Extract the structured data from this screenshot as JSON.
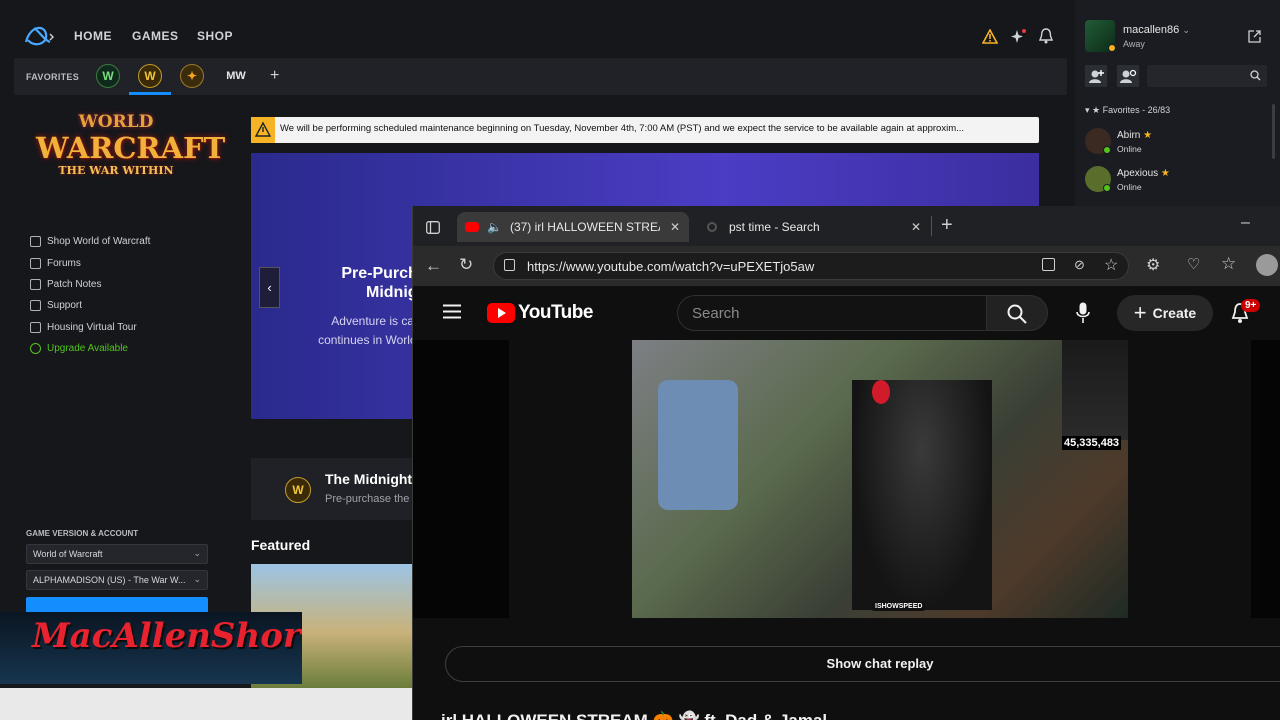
{
  "topnav": {
    "home": "HOME",
    "games": "GAMES",
    "shop": "SHOP"
  },
  "favorites": {
    "label": "FAVORITES",
    "add": "+",
    "games": [
      "WoW Classic",
      "World of Warcraft",
      "Hearthstone",
      "MW"
    ]
  },
  "user": {
    "name": "macallen86",
    "status": "Away"
  },
  "friends": {
    "header": "Favorites - 26/83",
    "list": [
      {
        "name": "Abirn",
        "status": "Online"
      },
      {
        "name": "Apexious",
        "status": "Online"
      }
    ]
  },
  "game": {
    "logo_line1": "WORLD",
    "logo_line2": "WARCRAFT",
    "logo_line3": "THE WAR WITHIN",
    "links": [
      "Shop World of Warcraft",
      "Forums",
      "Patch Notes",
      "Support",
      "Housing Virtual Tour"
    ],
    "upgrade": "Upgrade Available",
    "version_label": "GAME VERSION & ACCOUNT",
    "version_value": "World of Warcraft",
    "account_value": "ALPHAMADISON (US) - The War W..."
  },
  "banner": {
    "text": "We will be performing scheduled maintenance beginning on Tuesday, November 4th, 7:00 AM (PST) and we expect the service to be available again at approxim..."
  },
  "promo": {
    "title_line1": "Pre-Purcha",
    "title_line2": "Midnigl",
    "body_line1": "Adventure is cal",
    "body_line2": "continues in Worlc"
  },
  "news": {
    "title": "The Midnight",
    "subtitle": "Pre-purchase the"
  },
  "featured": {
    "label": "Featured"
  },
  "watermark": {
    "text": "MacAllenShorts"
  },
  "browser": {
    "tab1": "(37) irl HALLOWEEN STREAM",
    "tab2": "pst time - Search",
    "url": "https://www.youtube.com/watch?v=uPEXETjo5aw"
  },
  "youtube": {
    "brand": "YouTube",
    "search_placeholder": "Search",
    "create": "Create",
    "notif_badge": "9+",
    "video_counter": "45,335,483",
    "video_tag": "ISHOWSPEED",
    "chat_replay": "Show chat replay",
    "title_partial": "irl HALLOWEEN STREAM 🎃 👻 ft. Dad & Jamal"
  },
  "colors": {
    "accent": "#148eff",
    "warning": "#f5b325",
    "yt_red": "#ff0000",
    "green": "#52c41a"
  }
}
